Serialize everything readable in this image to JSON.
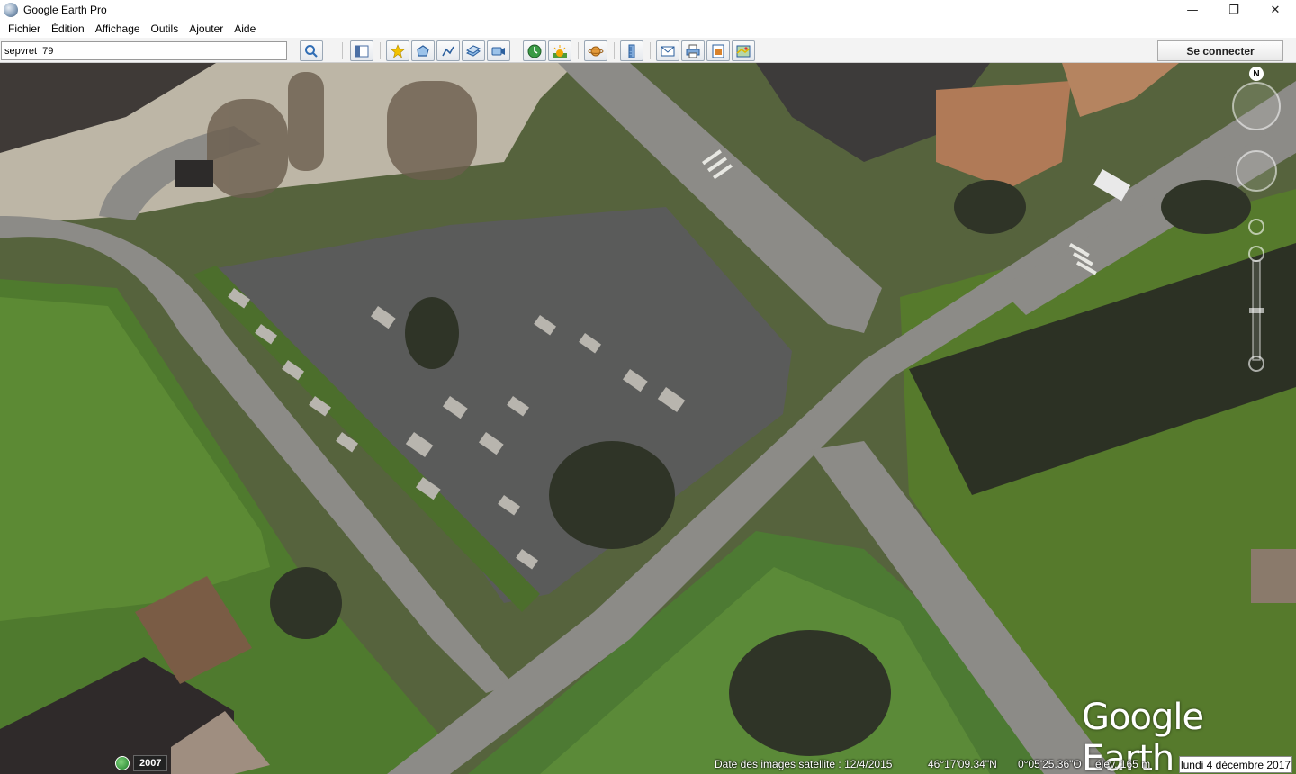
{
  "window": {
    "title": "Google Earth Pro",
    "controls": {
      "minimize": "—",
      "restore": "❐",
      "close": "✕"
    }
  },
  "menu": [
    {
      "label": "Fichier"
    },
    {
      "label": "Édition"
    },
    {
      "label": "Affichage"
    },
    {
      "label": "Outils"
    },
    {
      "label": "Ajouter"
    },
    {
      "label": "Aide"
    }
  ],
  "search": {
    "value": "sepvret  79"
  },
  "toolbar": {
    "connect_label": "Se connecter",
    "buttons": [
      {
        "name": "search-icon",
        "color": "#2f6db5"
      },
      {
        "name": "sidebar-toggle-icon",
        "color": "#4a6fa5"
      },
      {
        "name": "placemark-icon",
        "color": "#e0b800"
      },
      {
        "name": "polygon-icon",
        "color": "#3b7fc4"
      },
      {
        "name": "path-icon",
        "color": "#3b7fc4"
      },
      {
        "name": "image-overlay-icon",
        "color": "#3b7fc4"
      },
      {
        "name": "record-tour-icon",
        "color": "#3b7fc4"
      },
      {
        "name": "historical-imagery-icon",
        "color": "#2e8b3a"
      },
      {
        "name": "sunlight-icon",
        "color": "#e08a00"
      },
      {
        "name": "planets-icon",
        "color": "#d9822b"
      },
      {
        "name": "ruler-icon",
        "color": "#3b7fc4"
      },
      {
        "name": "email-icon",
        "color": "#3b7fc4"
      },
      {
        "name": "print-icon",
        "color": "#3b7fc4"
      },
      {
        "name": "save-image-icon",
        "color": "#3b7fc4"
      },
      {
        "name": "view-in-maps-icon",
        "color": "#3b7fc4"
      }
    ]
  },
  "map": {
    "compass_label": "N",
    "logo": "Google Earth"
  },
  "status": {
    "historical_year": "2007",
    "imagery_date": "Date des images satellite : 12/4/2015",
    "latitude": "46°17'09.34\"N",
    "longitude": "0°05'25.36\"O",
    "elevation": "élév.  165 m",
    "system_date": "lundi 4 décembre 2017"
  }
}
